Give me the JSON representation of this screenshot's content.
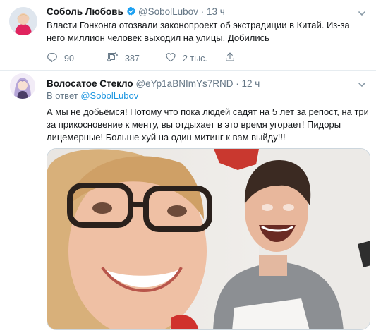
{
  "tweet": {
    "author_name": "Соболь Любовь",
    "author_handle": "@SobolLubov",
    "separator": "·",
    "time": "13 ч",
    "text": "Власти Гонконга отозвали законопроект об экстрадиции в Китай. Из-за него миллион человек выходил на улицы. Добились",
    "reply_count": "90",
    "retweet_count": "387",
    "like_count": "2 тыс.",
    "verified_color": "#1da1f2"
  },
  "reply": {
    "author_name": "Волосатое Стекло",
    "author_handle": "@eYp1aBNImYs7RND",
    "separator": "·",
    "time": "12 ч",
    "reply_prefix": "В ответ",
    "reply_to_handle": "@SobolLubov",
    "text": "А мы не добьёмся! Потому что пока людей садят на 5 лет за репост, на три за прикосновение к менту, вы отдыхает в это время угорает! Пидоры лицемерные! Больше хуй на один митинг к вам выйду!!!",
    "media_type": "video-frame"
  },
  "icons": {
    "reply": "reply-icon",
    "retweet": "retweet-icon",
    "like": "heart-icon",
    "share": "share-icon",
    "caret": "chevron-down-icon",
    "verified": "verified-badge-icon"
  },
  "colors": {
    "secondary_text": "#657786",
    "link": "#1b95e0",
    "divider": "#e6ecf0"
  }
}
